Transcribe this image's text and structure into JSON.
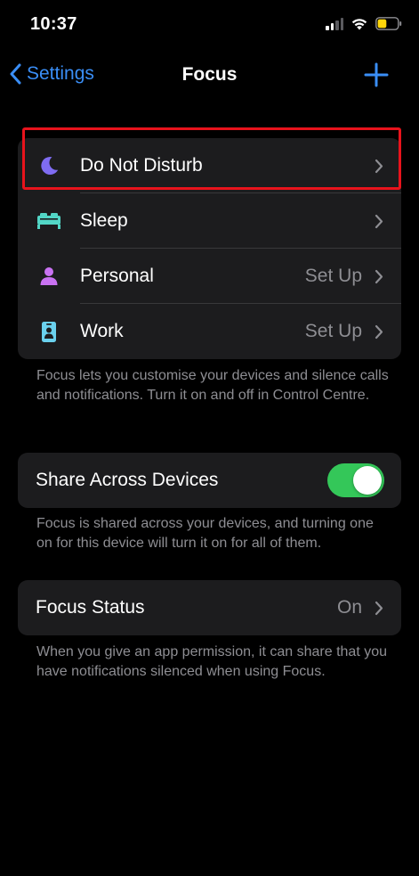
{
  "status_bar": {
    "time": "10:37",
    "icons": [
      "cellular-signal-icon",
      "wifi-icon",
      "battery-icon"
    ],
    "battery_level": 0.45,
    "battery_color": "#ffd60a"
  },
  "nav": {
    "back_label": "Settings",
    "title": "Focus",
    "add_icon": "plus-icon",
    "accent_color": "#3a8ef6"
  },
  "focus_modes": [
    {
      "label": "Do Not Disturb",
      "value": "",
      "icon": "moon-icon",
      "icon_color": "#7f6cf2"
    },
    {
      "label": "Sleep",
      "value": "",
      "icon": "bed-icon",
      "icon_color": "#52d6c6"
    },
    {
      "label": "Personal",
      "value": "Set Up",
      "icon": "person-icon",
      "icon_color": "#c972f2"
    },
    {
      "label": "Work",
      "value": "Set Up",
      "icon": "id-badge-icon",
      "icon_color": "#6ad1ee"
    }
  ],
  "focus_modes_footer": "Focus lets you customise your devices and silence calls and notifications. Turn it on and off in Control Centre.",
  "share_across_devices": {
    "label": "Share Across Devices",
    "enabled": true,
    "toggle_color": "#34c759",
    "footer": "Focus is shared across your devices, and turning one on for this device will turn it on for all of them."
  },
  "focus_status": {
    "label": "Focus Status",
    "value": "On",
    "footer": "When you give an app permission, it can share that you have notifications silenced when using Focus."
  },
  "highlight_color": "#e8131c"
}
